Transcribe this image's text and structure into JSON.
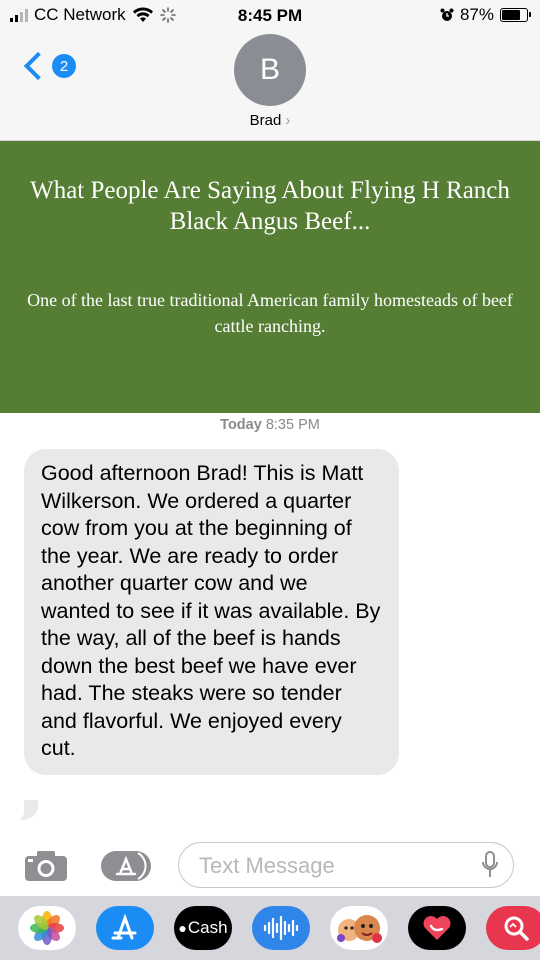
{
  "status_bar": {
    "carrier": "CC Network",
    "time": "8:45 PM",
    "battery_text": "87%",
    "battery_level": 0.87
  },
  "header": {
    "back_badge": "2",
    "avatar_initial": "B",
    "contact_name": "Brad"
  },
  "link_preview": {
    "title": "What People Are Saying About Flying H Ranch Black Angus Beef...",
    "description": "One of the last true traditional American family homesteads of beef cattle ranching.",
    "background_color": "#557d34"
  },
  "conversation": {
    "timestamp_day": "Today",
    "timestamp_time": "8:35 PM",
    "message": "Good afternoon Brad! This is Matt Wilkerson. We ordered a quarter cow from you at the beginning of the year. We are ready to order another quarter cow and we wanted to see if it was available. By the way, all of the beef is hands down the best beef we have ever had. The steaks were so tender and flavorful. We enjoyed every cut."
  },
  "compose": {
    "placeholder": "Text Message"
  },
  "app_drawer": {
    "apps": [
      {
        "icon": "photos-icon"
      },
      {
        "icon": "app-store-icon"
      },
      {
        "icon": "cash-app-icon",
        "label": "Cash"
      },
      {
        "icon": "audio-message-icon"
      },
      {
        "icon": "memoji-icon"
      },
      {
        "icon": "digital-touch-icon"
      },
      {
        "icon": "search-images-icon"
      }
    ]
  },
  "colors": {
    "accent": "#1c8cf5",
    "bubble": "#e9e9eb"
  }
}
